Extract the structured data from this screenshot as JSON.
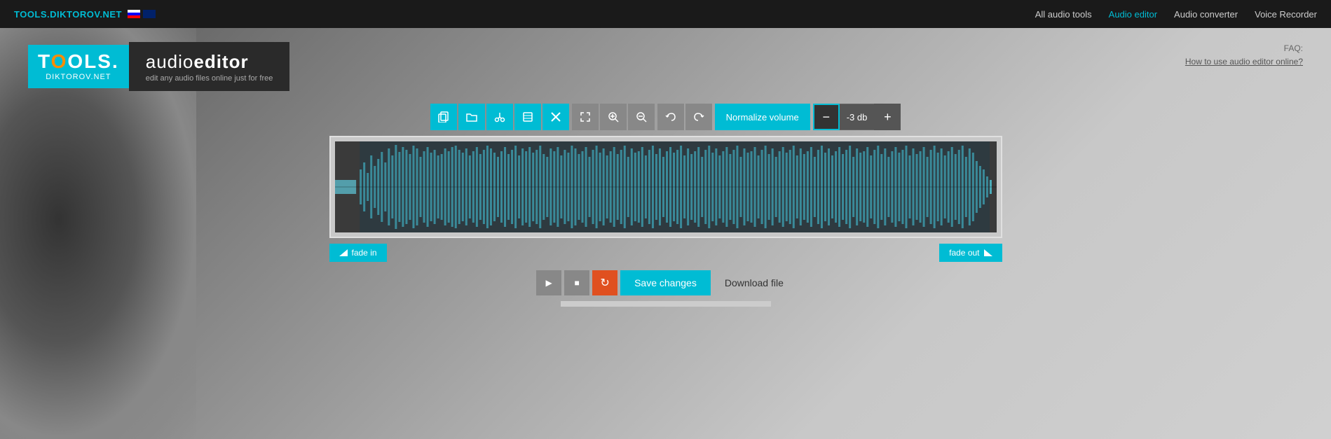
{
  "brand": {
    "site_url": "TOOLS.DIKTOROV.NET",
    "logo_text_1": "T",
    "logo_text_2": "OLS.",
    "logo_sub": "DIKTOROV.NET"
  },
  "audioeditor": {
    "title_light": "audio",
    "title_bold": "editor",
    "subtitle": "edit any audio files online just for free"
  },
  "faq": {
    "label": "FAQ:",
    "link_text": "How to use audio editor online?"
  },
  "nav": {
    "links": [
      {
        "label": "All audio tools",
        "active": false
      },
      {
        "label": "Audio editor",
        "active": true
      },
      {
        "label": "Audio converter",
        "active": false
      },
      {
        "label": "Voice Recorder",
        "active": false
      }
    ]
  },
  "toolbar": {
    "buttons": [
      {
        "id": "copy",
        "icon": "⧉",
        "title": "Copy"
      },
      {
        "id": "open",
        "icon": "📂",
        "title": "Open file"
      },
      {
        "id": "cut",
        "icon": "✂",
        "title": "Cut"
      },
      {
        "id": "trim",
        "icon": "⬛",
        "title": "Trim"
      },
      {
        "id": "delete",
        "icon": "✕",
        "title": "Delete"
      }
    ],
    "buttons2": [
      {
        "id": "fullscreen",
        "icon": "⤢",
        "title": "Full screen"
      },
      {
        "id": "zoom-in",
        "icon": "🔍+",
        "title": "Zoom in"
      },
      {
        "id": "zoom-out",
        "icon": "🔍-",
        "title": "Zoom out"
      }
    ],
    "buttons3": [
      {
        "id": "undo",
        "icon": "↩",
        "title": "Undo"
      },
      {
        "id": "redo",
        "icon": "↪",
        "title": "Redo"
      }
    ],
    "normalize_label": "Normalize volume",
    "vol_db": "-3 db",
    "vol_minus": "−",
    "vol_plus": "+"
  },
  "waveform": {
    "fade_in_label": "fade in",
    "fade_out_label": "fade out"
  },
  "playback": {
    "play_icon": "▶",
    "stop_icon": "■",
    "refresh_icon": "↻",
    "save_label": "Save changes",
    "download_label": "Download file"
  }
}
